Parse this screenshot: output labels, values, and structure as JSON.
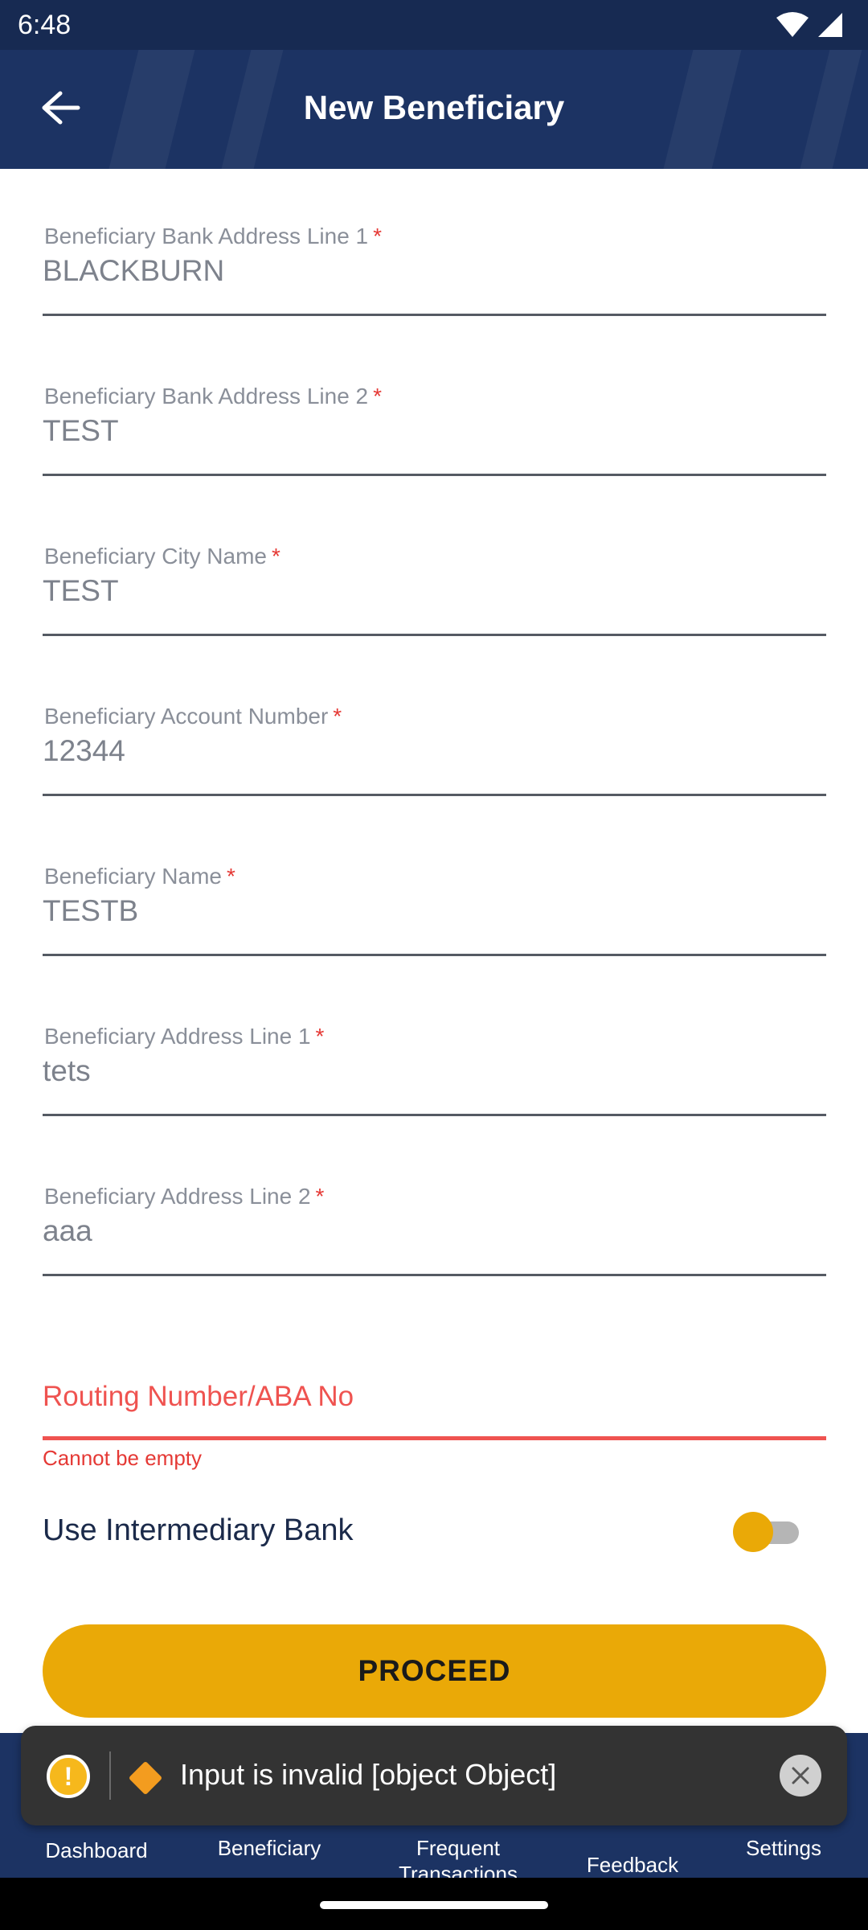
{
  "status_bar": {
    "time": "6:48"
  },
  "header": {
    "title": "New Beneficiary"
  },
  "form": {
    "fields": [
      {
        "label": "Beneficiary Bank Address Line 1",
        "value": "BLACKBURN"
      },
      {
        "label": "Beneficiary Bank Address Line 2",
        "value": "TEST"
      },
      {
        "label": "Beneficiary City Name",
        "value": "TEST"
      },
      {
        "label": "Beneficiary Account Number",
        "value": "12344"
      },
      {
        "label": "Beneficiary Name",
        "value": "TESTB"
      },
      {
        "label": "Beneficiary Address Line 1",
        "value": "tets"
      },
      {
        "label": "Beneficiary Address Line 2",
        "value": "aaa"
      }
    ],
    "required_marker": "*",
    "routing": {
      "placeholder": "Routing Number/ABA No",
      "error": "Cannot be empty"
    },
    "intermediary": {
      "label": "Use Intermediary Bank",
      "enabled": false
    },
    "proceed_label": "PROCEED"
  },
  "toast": {
    "message": "Input is invalid [object Object]"
  },
  "bottom_nav": {
    "items": [
      {
        "label": "Dashboard"
      },
      {
        "label": "Beneficiary"
      },
      {
        "label": "Frequent\nTransactions"
      },
      {
        "label": "Feedback"
      },
      {
        "label": "Settings"
      }
    ]
  },
  "colors": {
    "primary": "#1c3363",
    "accent": "#eaa907",
    "error": "#ef5350"
  }
}
